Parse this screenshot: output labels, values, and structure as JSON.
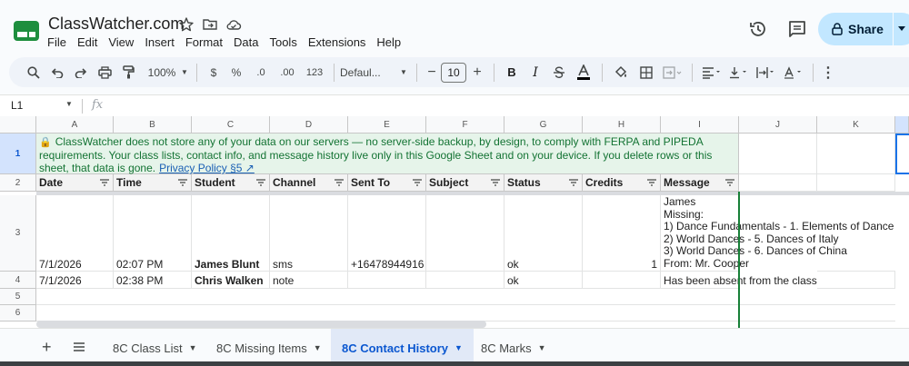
{
  "app": {
    "title": "ClassWatcher.com",
    "menu": [
      "File",
      "Edit",
      "View",
      "Insert",
      "Format",
      "Data",
      "Tools",
      "Extensions",
      "Help"
    ],
    "share_label": "Share"
  },
  "toolbar": {
    "zoom": "100%",
    "currency": "$",
    "percent": "%",
    "decrease_decimals": ".0",
    "increase_decimals": ".00",
    "number_format": "123",
    "font_family": "Defaul...",
    "font_size": "10",
    "bold": "B",
    "italic": "I"
  },
  "formula_bar": {
    "name_box": "L1",
    "fx": "fx"
  },
  "grid": {
    "columns": [
      "A",
      "B",
      "C",
      "D",
      "E",
      "F",
      "G",
      "H",
      "I",
      "J",
      "K"
    ],
    "rows": [
      "1",
      "2",
      "3",
      "4",
      "5",
      "6"
    ],
    "banner": {
      "text": "ClassWatcher does not store any of your data on our servers — no server-side backup, by design, to comply with FERPA and PIPEDA requirements. Your class lists, contact info, and message history live only in this Google Sheet and on your device. If you delete rows or this sheet, that data is gone.",
      "link": "Privacy Policy §5 ↗"
    },
    "headers": [
      "Date",
      "Time",
      "Student",
      "Channel",
      "Sent To",
      "Subject",
      "Status",
      "Credits",
      "Message"
    ],
    "records": [
      {
        "date": "7/1/2026",
        "time": "02:07 PM",
        "student": "James Blunt",
        "channel": "sms",
        "sent_to": "+16478944916",
        "subject": "",
        "status": "ok",
        "credits": "1",
        "message_lines": [
          "James",
          "Missing:",
          "1) Dance Fundamentals - 1. Elements of Dance",
          "2) World Dances - 5. Dances of Italy",
          "3) World Dances - 6. Dances of China",
          "From: Mr. Cooper"
        ]
      },
      {
        "date": "7/1/2026",
        "time": "02:38 PM",
        "student": "Chris Walken",
        "channel": "note",
        "sent_to": "",
        "subject": "",
        "status": "ok",
        "credits": "",
        "message_lines": [
          "Has been absent from the class"
        ]
      }
    ]
  },
  "sheet_tabs": [
    {
      "label": "8C Class List",
      "active": false
    },
    {
      "label": "8C Missing Items",
      "active": false
    },
    {
      "label": "8C Contact History",
      "active": true
    },
    {
      "label": "8C Marks",
      "active": false
    }
  ],
  "colors": {
    "accent": "#0b57d0",
    "share_bg": "#c2e7ff",
    "banner_bg": "#e6f4ea",
    "banner_text": "#137333",
    "header_bg": "#f3f3f3"
  }
}
